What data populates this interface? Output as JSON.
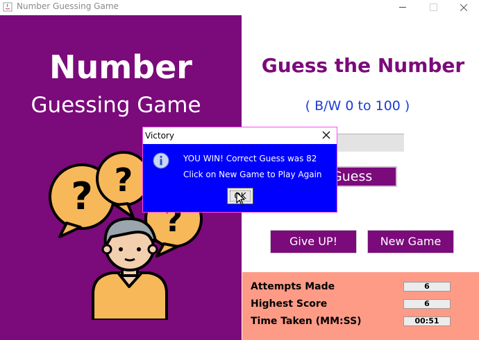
{
  "window": {
    "title": "Number Guessing Game"
  },
  "left_panel": {
    "heading_line1": "Number",
    "heading_line2": "Guessing Game"
  },
  "main": {
    "title": "Guess the Number",
    "range_hint": "( B/W 0 to 100 )",
    "guess_input_value": "",
    "guess_button": "Guess",
    "give_up_button": "Give UP!",
    "new_game_button": "New Game"
  },
  "stats": [
    {
      "label": "Attempts Made",
      "value": "6"
    },
    {
      "label": "Highest Score",
      "value": "6"
    },
    {
      "label": "Time Taken (MM:SS)",
      "value": "00:51"
    }
  ],
  "dialog": {
    "title": "Victory",
    "message_line1": "YOU WIN! Correct Guess was 82",
    "message_line2": "Click on New Game to Play Again",
    "ok_button": "OK"
  },
  "colors": {
    "purple": "#7b0a7b",
    "blue_text": "#1a3bd8",
    "stats_bg": "#fd9b87",
    "dialog_bg": "#0000ff"
  },
  "icons": [
    "java-app-icon",
    "info-icon",
    "question-bubble-icon",
    "person-icon",
    "mouse-cursor-icon"
  ]
}
